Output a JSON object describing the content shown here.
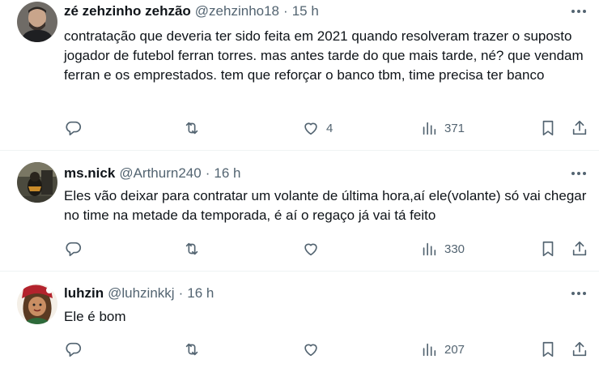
{
  "tweets": [
    {
      "name": "zé zehzinho zehzão",
      "handle": "@zehzinho18",
      "separator": "·",
      "time": "15 h",
      "text": "contratação que deveria ter sido feita em 2021 quando resolveram trazer o suposto jogador de futebol ferran torres. mas antes tarde do que mais tarde, né? que vendam ferran e os emprestados. tem que reforçar o banco tbm, time precisa ter banco",
      "likes": "4",
      "views": "371"
    },
    {
      "name": "ms.nick",
      "handle": "@Arthurn240",
      "separator": "·",
      "time": "16 h",
      "text": "Eles vão deixar para contratar um volante de última hora,aí ele(volante) só vai chegar no time na metade da temporada, é aí o regaço já vai tá feito",
      "likes": "",
      "views": "330"
    },
    {
      "name": "luhzin",
      "handle": "@luhzinkkj",
      "separator": "·",
      "time": "16 h",
      "text": "Ele é bom",
      "likes": "",
      "views": "207"
    }
  ],
  "icons": {
    "more": "more-dots-icon",
    "reply": "reply-icon",
    "retweet": "retweet-icon",
    "like": "heart-icon",
    "views": "views-chart-icon",
    "bookmark": "bookmark-icon",
    "share": "share-icon"
  },
  "colors": {
    "text": "#0f1419",
    "secondary": "#536471",
    "divider": "#eff3f4"
  }
}
